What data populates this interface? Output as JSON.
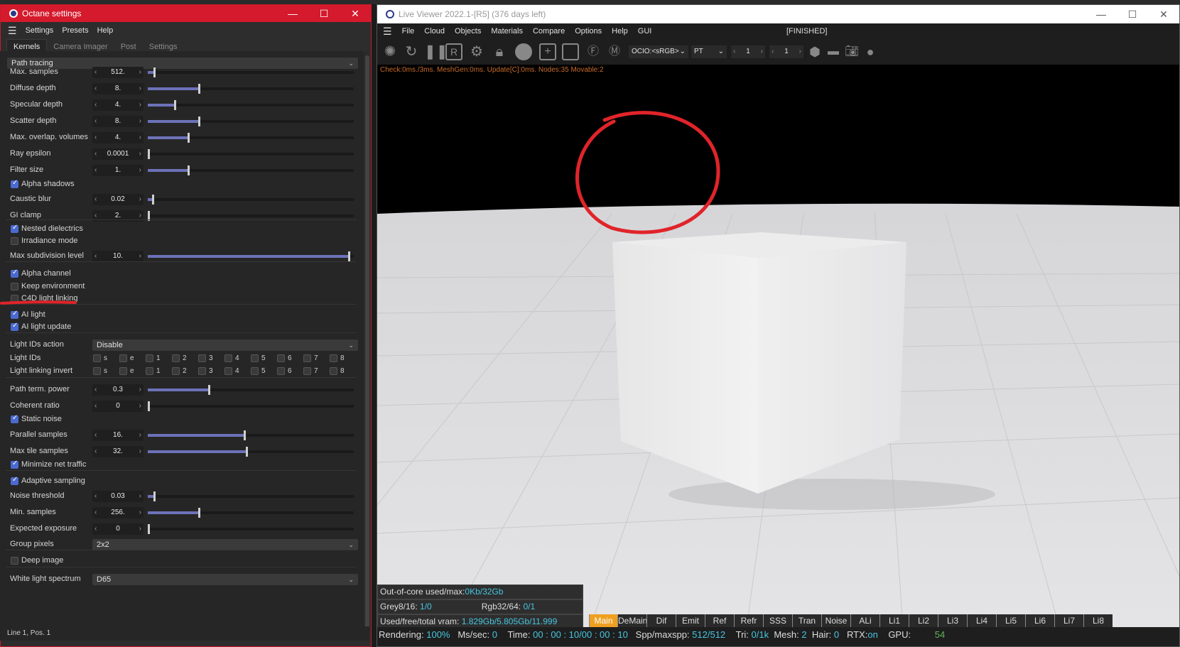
{
  "octane": {
    "title": "Octane settings",
    "menu": [
      "Settings",
      "Presets",
      "Help"
    ],
    "tabs": [
      "Kernels",
      "Camera Imager",
      "Post",
      "Settings"
    ],
    "kernel": "Path tracing",
    "status": "Line 1, Pos. 1",
    "params": {
      "max_samples": {
        "label": "Max. samples",
        "value": "512.",
        "level": 0.03
      },
      "diffuse_depth": {
        "label": "Diffuse depth",
        "value": "8.",
        "level": 0.25
      },
      "specular_depth": {
        "label": "Specular depth",
        "value": "4.",
        "level": 0.13
      },
      "scatter_depth": {
        "label": "Scatter depth",
        "value": "8.",
        "level": 0.25
      },
      "max_overlap": {
        "label": "Max. overlap. volumes",
        "value": "4.",
        "level": 0.2
      },
      "ray_epsilon": {
        "label": "Ray epsilon",
        "value": "0.0001",
        "level": 0.0
      },
      "filter_size": {
        "label": "Filter size",
        "value": "1.",
        "level": 0.2
      },
      "caustic_blur": {
        "label": "Caustic blur",
        "value": "0.02",
        "level": 0.02
      },
      "gi_clamp": {
        "label": "GI clamp",
        "value": "2.",
        "level": 0.0
      },
      "max_subdiv": {
        "label": "Max subdivision level",
        "value": "10.",
        "level": 1.0
      },
      "path_term": {
        "label": "Path term. power",
        "value": "0.3",
        "level": 0.3
      },
      "coherent": {
        "label": "Coherent ratio",
        "value": "0",
        "level": 0.0
      },
      "parallel": {
        "label": "Parallel samples",
        "value": "16.",
        "level": 0.48
      },
      "max_tile": {
        "label": "Max tile samples",
        "value": "32.",
        "level": 0.49
      },
      "noise_thr": {
        "label": "Noise threshold",
        "value": "0.03",
        "level": 0.03
      },
      "min_samples": {
        "label": "Min. samples",
        "value": "256.",
        "level": 0.25
      },
      "exposure": {
        "label": "Expected exposure",
        "value": "0",
        "level": 0.0
      }
    },
    "checks": {
      "alpha_shadows": "Alpha shadows",
      "nested": "Nested dielectrics",
      "irradiance": "Irradiance mode",
      "alpha_channel": "Alpha channel",
      "keep_env": "Keep environment",
      "c4d_link": "C4D light linking",
      "ai_light": "AI light",
      "ai_update": "AI light update",
      "static_noise": "Static noise",
      "min_net": "Minimize net traffic",
      "adaptive": "Adaptive sampling",
      "deep": "Deep image"
    },
    "light_ids_action": {
      "label": "Light IDs action",
      "value": "Disable"
    },
    "light_ids": {
      "label": "Light IDs",
      "invert_label": "Light linking invert",
      "items": [
        "s",
        "e",
        "1",
        "2",
        "3",
        "4",
        "5",
        "6",
        "7",
        "8"
      ]
    },
    "group_pixels": {
      "label": "Group pixels",
      "value": "2x2"
    },
    "white_light": {
      "label": "White light spectrum",
      "value": "D65"
    }
  },
  "viewer": {
    "title": "Live Viewer 2022.1-[R5] (376 days left)",
    "menu": [
      "File",
      "Cloud",
      "Objects",
      "Materials",
      "Compare",
      "Options",
      "Help",
      "GUI"
    ],
    "state": "[FINISHED]",
    "ocio": "OCIO:<sRGB>",
    "kernel": "PT",
    "counter1": "1",
    "counter2": "1",
    "message": "Check:0ms./3ms. MeshGen:0ms. Update[C]:0ms. Nodes:35 Movable:2",
    "stats": {
      "ooc_label": "Out-of-core used/max:",
      "ooc_value": "0Kb/32Gb",
      "grey_label": "Grey8/16:",
      "grey_value": "1/0",
      "rgb_label": "Rgb32/64:",
      "rgb_value": "0/1",
      "vram_label": "Used/free/total vram:",
      "vram_value": "1.829Gb/5.805Gb/11.999"
    },
    "passes": [
      "Main",
      "DeMain",
      "Dif",
      "Emit",
      "Ref",
      "Refr",
      "SSS",
      "Tran",
      "Noise",
      "ALi",
      "Li1",
      "Li2",
      "Li3",
      "Li4",
      "Li5",
      "Li6",
      "Li7",
      "Li8"
    ],
    "bar": {
      "rendering_label": "Rendering:",
      "rendering": "100%",
      "ms_label": "Ms/sec:",
      "ms": "0",
      "time_label": "Time:",
      "time": "00 : 00 : 10/00 : 00 : 10",
      "spp_label": "Spp/maxspp:",
      "spp": "512/512",
      "tri_label": "Tri:",
      "tri": "0/1k",
      "mesh_label": "Mesh:",
      "mesh": "2",
      "hair_label": "Hair:",
      "hair": "0",
      "rtx_label": "RTX:",
      "rtx": "on",
      "gpu_label": "GPU:",
      "gpu": "54"
    }
  },
  "colors": {
    "accent": "#d41a2c",
    "slider": "#6c72b8",
    "stat": "#46c6e0",
    "pass_active": "#f0a020",
    "annotation": "#e0242a"
  }
}
